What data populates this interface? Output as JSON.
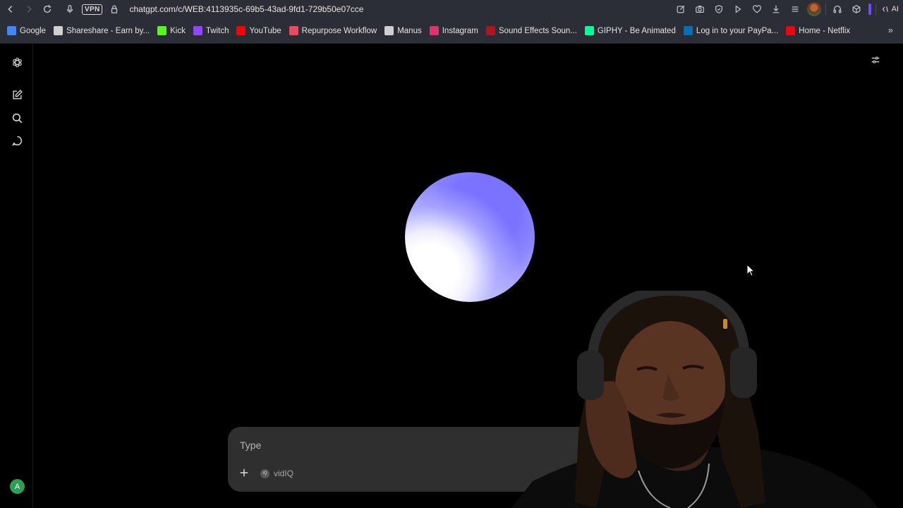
{
  "browser": {
    "vpn_label": "VPN",
    "url": "chatgpt.com/c/WEB:4113935c-69b5-43ad-9fd1-729b50e07cce",
    "ai_label": "AI"
  },
  "bookmarks": [
    {
      "label": "Google",
      "icon": "google-icon",
      "color": "#4285f4"
    },
    {
      "label": "Shareshare - Earn by...",
      "icon": "page-icon",
      "color": "#d0d0d0"
    },
    {
      "label": "Kick",
      "icon": "kick-icon",
      "color": "#53fc18"
    },
    {
      "label": "Twitch",
      "icon": "twitch-icon",
      "color": "#9146ff"
    },
    {
      "label": "YouTube",
      "icon": "youtube-icon",
      "color": "#ff0000"
    },
    {
      "label": "Repurpose Workflow",
      "icon": "repurpose-icon",
      "color": "#e84a5f"
    },
    {
      "label": "Manus",
      "icon": "manus-icon",
      "color": "#cfcfcf"
    },
    {
      "label": "Instagram",
      "icon": "instagram-icon",
      "color": "#e1306c"
    },
    {
      "label": "Sound Effects Soun...",
      "icon": "sound-effects-icon",
      "color": "#b3141c"
    },
    {
      "label": "GIPHY - Be Animated",
      "icon": "giphy-icon",
      "color": "#00ff99"
    },
    {
      "label": "Log in to your PayPa...",
      "icon": "paypal-icon",
      "color": "#0070ba"
    },
    {
      "label": "Home - Netflix",
      "icon": "netflix-icon",
      "color": "#e50914"
    }
  ],
  "app": {
    "composer_placeholder": "Type",
    "vidiq_label": "vidIQ",
    "user_initial": "A"
  },
  "colors": {
    "orb_primary": "#7b73ff",
    "composer_bg": "#2f2f2f",
    "avatar_green": "#2e9e52"
  }
}
